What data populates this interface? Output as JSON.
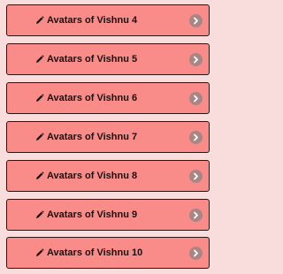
{
  "list": {
    "items": [
      {
        "label": "Avatars of Vishnu 4",
        "icon": "pencil-icon"
      },
      {
        "label": "Avatars of Vishnu 5",
        "icon": "pencil-icon"
      },
      {
        "label": "Avatars of Vishnu 6",
        "icon": "pencil-icon"
      },
      {
        "label": "Avatars of Vishnu 7",
        "icon": "pencil-icon"
      },
      {
        "label": "Avatars of Vishnu 8",
        "icon": "pencil-icon"
      },
      {
        "label": "Avatars of Vishnu 9",
        "icon": "pencil-icon"
      },
      {
        "label": "Avatars of Vishnu 10",
        "icon": "pencil-icon"
      }
    ],
    "trailing_icon": "chevron-right-icon"
  },
  "colors": {
    "background": "#f9dcdc",
    "item_fill": "#f98b88",
    "item_border": "#2a1515",
    "chevron_circle": "#a98583"
  }
}
